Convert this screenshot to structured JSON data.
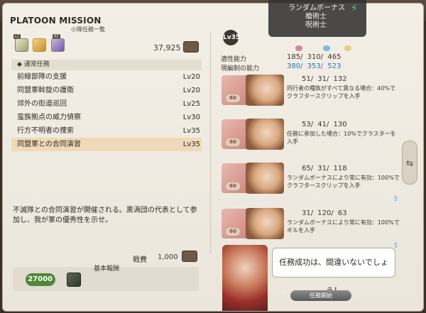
{
  "window": {
    "title": "PLATOON MISSION",
    "subtitle": "小隊任務一覧"
  },
  "categories": [
    {
      "key": "LT",
      "icon": "map-icon"
    },
    {
      "key": "",
      "icon": "scroll-icon"
    },
    {
      "key": "RT",
      "icon": "quill-icon"
    }
  ],
  "seals_count": "37,925",
  "list": {
    "header": "◆ 通常任務",
    "items": [
      {
        "name": "前線部隊の支援",
        "level": "Lv20"
      },
      {
        "name": "同盟軍斡旋の護衛",
        "level": "Lv20"
      },
      {
        "name": "郊外の街道巡回",
        "level": "Lv25"
      },
      {
        "name": "蛮族拠点の威力偵察",
        "level": "Lv30"
      },
      {
        "name": "行方不明者の捜索",
        "level": "Lv35"
      },
      {
        "name": "同盟軍との合同演習",
        "level": "Lv35"
      }
    ]
  },
  "description": "不滅隊との合同演習が開催される。黒渦団の代表として参加し、我が軍の優秀性を示せ。",
  "reward": {
    "label": "戦費",
    "value": "1,000"
  },
  "basic_reward": {
    "label": "基本報酬",
    "gil": "27000"
  },
  "party": {
    "level_badge": "Lv35",
    "suited_label": "適性能力",
    "suited_values": "185/ 310/ 465",
    "current_label": "現編制の能力",
    "current_values": "380/ 353/ 523",
    "members": [
      {
        "level": "60",
        "stats": "51/ 31/ 132",
        "note": "同行者の種族がすべて異なる場合：40%でクラフタースクリップを入手"
      },
      {
        "level": "60",
        "stats": "53/ 41/ 130",
        "note": "任務に参加した場合：10%でクラスターを入手"
      },
      {
        "level": "60",
        "stats": "65/ 31/ 118",
        "note": "ランダムボーナスにより常に有効：100%でクラフタースクリップを入手"
      },
      {
        "level": "60",
        "stats": "31/ 120/ 63",
        "note": "ランダムボーナスにより常に有効：100%でギルを入手"
      }
    ]
  },
  "bonus": {
    "title": "ランダムボーナス",
    "lines": [
      "槍術士",
      "呪術士"
    ]
  },
  "npc_speech": "任務成功は、間違いないでしょう！",
  "start_button": "任務開始",
  "colors": {
    "panel": "#efe9df",
    "selected_row": "#f0d9b8",
    "accent_blue": "#2f70b8",
    "level_red": "#a23c2c"
  }
}
